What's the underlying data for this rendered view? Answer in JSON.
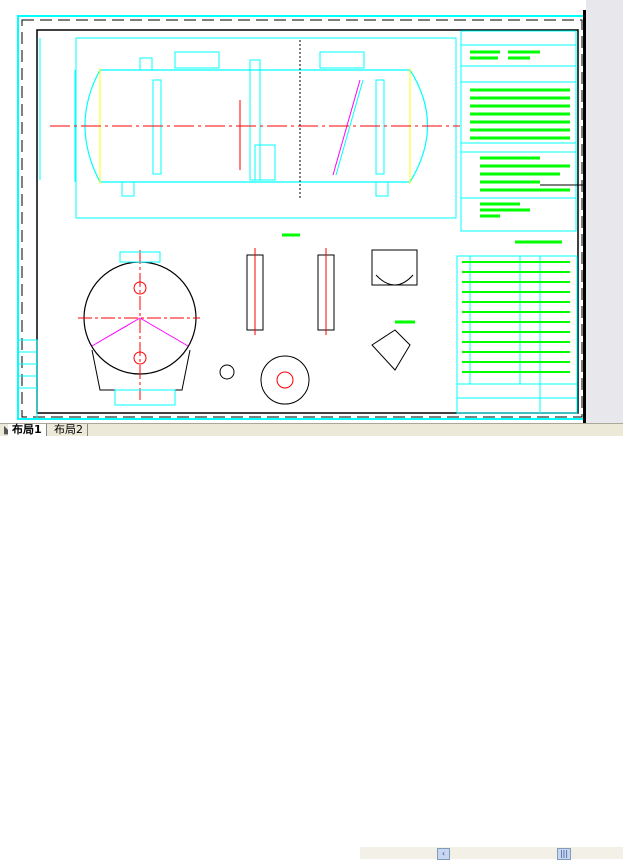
{
  "layout_tabs": [
    {
      "label": "布局1",
      "active": true
    },
    {
      "label": "布局2",
      "active": false
    }
  ],
  "scroll": {
    "left_icon": "chevron-left-icon",
    "thumb_icon": "scroll-thumb-icon"
  },
  "colors": {
    "background": "#ffffff",
    "frame": "#000000",
    "viewport": "#00ffff",
    "text": "#00ff00",
    "centerline": "#ff0000",
    "highlight": "#ff00ff",
    "tab_bar": "#ece9d8"
  }
}
